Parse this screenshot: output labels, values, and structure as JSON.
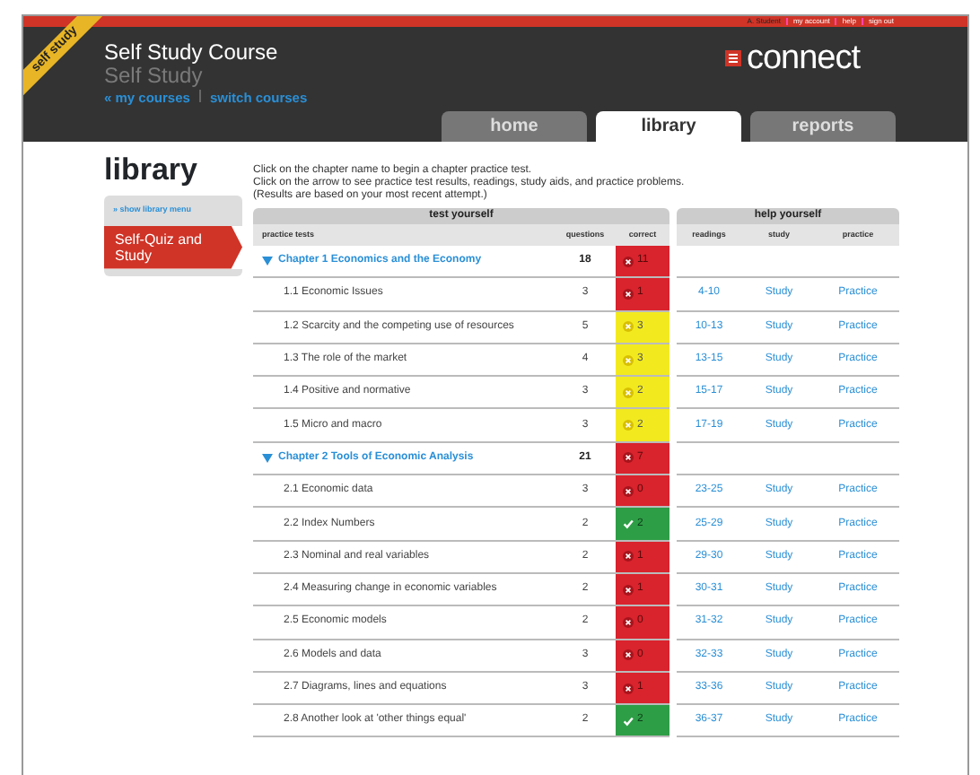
{
  "ribbon": "self study",
  "user_links": [
    "A. Student",
    "my account",
    "help",
    "sign out"
  ],
  "course": {
    "title": "Self Study Course",
    "subtitle": "Self Study"
  },
  "course_links": [
    "« my courses",
    "switch courses"
  ],
  "logo": "connect",
  "tabs": [
    {
      "label": "home",
      "selected": false
    },
    {
      "label": "library",
      "selected": true
    },
    {
      "label": "reports",
      "selected": false
    }
  ],
  "page_title": "library",
  "side": {
    "menu_link": "» show library menu",
    "item": "Self-Quiz and Study"
  },
  "instructions": [
    "Click on the chapter name to begin a chapter practice test.",
    "Click on the arrow to see practice test results, readings, study aids, and practice problems.",
    "(Results are based on your most recent attempt.)"
  ],
  "test_header": "test yourself",
  "help_header": "help yourself",
  "columns": [
    "practice tests",
    "questions",
    "correct",
    "readings",
    "study",
    "practice"
  ],
  "chapters": [
    {
      "title": "Chapter 1 Economics and the Economy",
      "expanded": true,
      "questions": "18",
      "kind": "wrong",
      "correct": "11",
      "sections": [
        {
          "title": "1.1 Economic Issues",
          "questions": "3",
          "kind": "wrong",
          "correct": "1",
          "readings": "4-10",
          "study": "Study",
          "practice": "Practice"
        },
        {
          "title": "1.2 Scarcity and the competing use of resources",
          "questions": "5",
          "kind": "partial",
          "correct": "3",
          "readings": "10-13",
          "study": "Study",
          "practice": "Practice"
        },
        {
          "title": "1.3 The role of the market",
          "questions": "4",
          "kind": "partial",
          "correct": "3",
          "readings": "13-15",
          "study": "Study",
          "practice": "Practice"
        },
        {
          "title": "1.4 Positive and normative",
          "questions": "3",
          "kind": "partial",
          "correct": "2",
          "readings": "15-17",
          "study": "Study",
          "practice": "Practice"
        },
        {
          "title": "1.5 Micro and macro",
          "questions": "3",
          "kind": "partial",
          "correct": "2",
          "readings": "17-19",
          "study": "Study",
          "practice": "Practice"
        }
      ]
    },
    {
      "title": "Chapter 2 Tools of Economic Analysis",
      "expanded": true,
      "questions": "21",
      "kind": "wrong",
      "correct": "7",
      "sections": [
        {
          "title": "2.1 Economic data",
          "questions": "3",
          "kind": "wrong",
          "correct": "0",
          "readings": "23-25",
          "study": "Study",
          "practice": "Practice"
        },
        {
          "title": "2.2 Index Numbers",
          "questions": "2",
          "kind": "right",
          "correct": "2",
          "readings": "25-29",
          "study": "Study",
          "practice": "Practice"
        },
        {
          "title": "2.3 Nominal and real variables",
          "questions": "2",
          "kind": "wrong",
          "correct": "1",
          "readings": "29-30",
          "study": "Study",
          "practice": "Practice"
        },
        {
          "title": "2.4 Measuring change in economic variables",
          "questions": "2",
          "kind": "wrong",
          "correct": "1",
          "readings": "30-31",
          "study": "Study",
          "practice": "Practice"
        },
        {
          "title": "2.5 Economic models",
          "questions": "2",
          "kind": "wrong",
          "correct": "0",
          "readings": "31-32",
          "study": "Study",
          "practice": "Practice"
        },
        {
          "title": "2.6 Models and data",
          "questions": "3",
          "kind": "wrong",
          "correct": "0",
          "readings": "32-33",
          "study": "Study",
          "practice": "Practice"
        },
        {
          "title": "2.7 Diagrams, lines and equations",
          "questions": "3",
          "kind": "wrong",
          "correct": "1",
          "readings": "33-36",
          "study": "Study",
          "practice": "Practice"
        },
        {
          "title": "2.8 Another look at 'other things equal'",
          "questions": "2",
          "kind": "right",
          "correct": "2",
          "readings": "36-37",
          "study": "Study",
          "practice": "Practice"
        }
      ]
    }
  ]
}
